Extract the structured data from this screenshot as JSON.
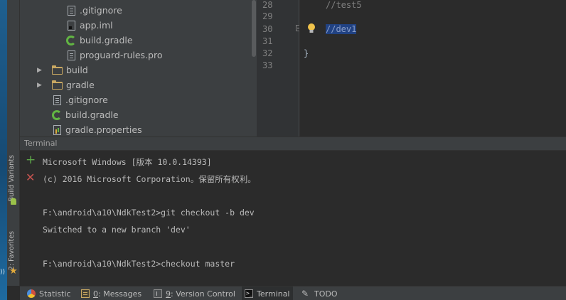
{
  "project_tree": {
    "items": [
      {
        "label": ".gitignore",
        "icon": "file-icon"
      },
      {
        "label": "app.iml",
        "icon": "iml-file-icon"
      },
      {
        "label": "build.gradle",
        "icon": "gradle-icon"
      },
      {
        "label": "proguard-rules.pro",
        "icon": "file-icon"
      },
      {
        "label": "build",
        "icon": "folder-icon"
      },
      {
        "label": "gradle",
        "icon": "folder-icon"
      },
      {
        "label": ".gitignore",
        "icon": "file-icon"
      },
      {
        "label": "build.gradle",
        "icon": "gradle-icon"
      },
      {
        "label": "gradle.properties",
        "icon": "properties-file-icon"
      }
    ]
  },
  "editor": {
    "line_numbers": [
      "28",
      "29",
      "30",
      "31",
      "32",
      "33"
    ],
    "lines": {
      "l28": "//test5",
      "l30": "//dev1",
      "l32": "}"
    }
  },
  "side_tabs": {
    "build_variants": "Build Variants",
    "favorites": "2: Favorites"
  },
  "terminal": {
    "title": "Terminal",
    "add_glyph": "+",
    "close_glyph": "✕",
    "lines": [
      "Microsoft Windows [版本 10.0.14393]",
      "(c) 2016 Microsoft Corporation。保留所有权利。",
      "",
      "F:\\android\\a10\\NdkTest2>git checkout -b dev",
      "Switched to a new branch 'dev'",
      "",
      "F:\\android\\a10\\NdkTest2>checkout master"
    ]
  },
  "bottom_tabs": {
    "statistic": "Statistic",
    "messages_key": "0",
    "messages": ": Messages",
    "vcs_key": "9",
    "vcs": ": Version Control",
    "terminal": "Terminal",
    "todo": "TODO"
  },
  "colors": {
    "tree_bg": "#3c3f41",
    "editor_bg": "#2b2b2b",
    "selection": "#214283",
    "comment": "#808080"
  }
}
